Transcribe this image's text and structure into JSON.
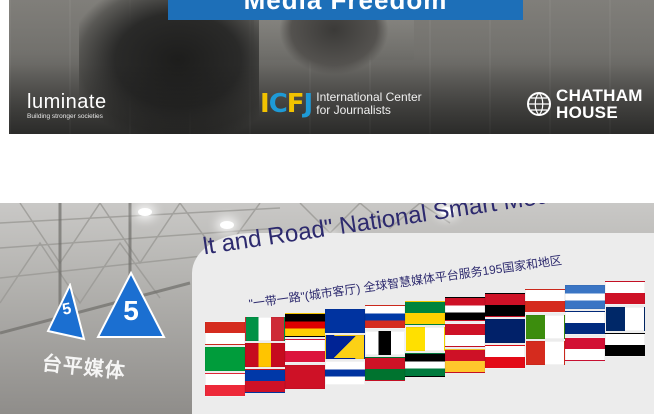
{
  "banner": {
    "headline": "Media Freedom",
    "logos": {
      "luminate": {
        "name": "luminate",
        "tagline": "Building stronger societies"
      },
      "icfj": {
        "mark": "ICFJ",
        "name_line1": "International Center",
        "name_line2": "for Journalists"
      },
      "chatham": {
        "name_line1": "CHATHAM",
        "name_line2": "HOUSE",
        "icon": "globe-icon"
      }
    }
  },
  "hall": {
    "sign_number": "5",
    "sign_number_small": "5",
    "platform_title": "lt and Road\" National Smart Media Platform",
    "platform_subtitle": "\"一带一路\"(城市客厅) 全球智慧媒体平台服务195国家和地区",
    "left_chinese_text": "台平媒体"
  }
}
